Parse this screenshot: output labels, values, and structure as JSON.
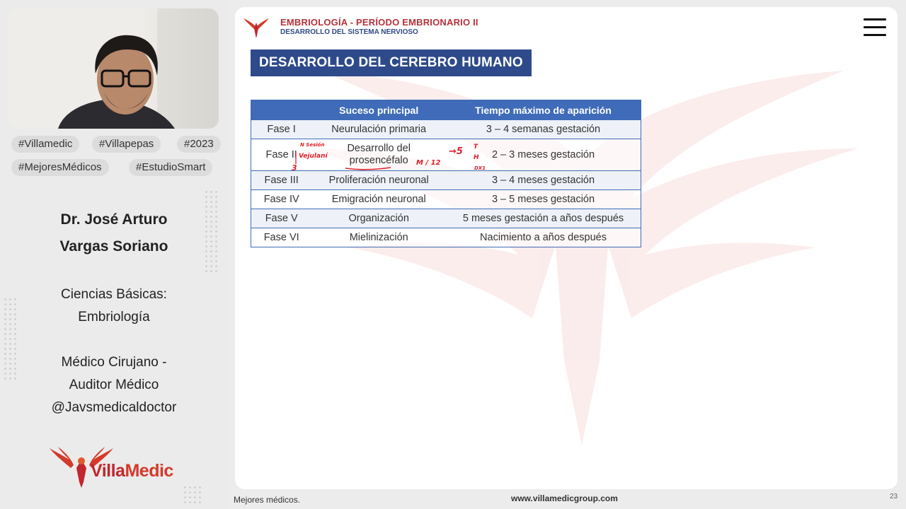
{
  "sidebar": {
    "tags": [
      "#Villamedic",
      "#Villapepas",
      "#2023",
      "#MejoresMédicos",
      "#EstudioSmart"
    ],
    "doctor_name_line1": "Dr. José Arturo",
    "doctor_name_line2": "Vargas Soriano",
    "area_line1": "Ciencias Básicas:",
    "area_line2": "Embriología",
    "role_line1": "Médico Cirujano -",
    "role_line2": "Auditor Médico",
    "handle": "@Javsmedicaldoctor",
    "logo_part1": "Villa",
    "logo_part2": "Medic"
  },
  "slide": {
    "course_title": "EMBRIOLOGÍA - PERÍODO EMBRIONARIO II",
    "course_subtitle": "DESARROLLO DEL SISTEMA NERVIOSO",
    "section_title": "DESARROLLO DEL CEREBRO HUMANO",
    "table": {
      "headers": [
        "",
        "Suceso principal",
        "Tiempo máximo de aparición"
      ],
      "rows": [
        {
          "phase": "Fase I",
          "event": "Neurulación primaria",
          "time": "3 – 4 semanas gestación"
        },
        {
          "phase": "Fase II",
          "event_line1": "Desarrollo del",
          "event_line2": "prosencéfalo",
          "time": "2 – 3 meses gestación"
        },
        {
          "phase": "Fase III",
          "event": "Proliferación neuronal",
          "time": "3 – 4 meses gestación"
        },
        {
          "phase": "Fase IV",
          "event": "Emigración neuronal",
          "time": "3 – 5 meses gestación"
        },
        {
          "phase": "Fase V",
          "event": "Organización",
          "time": "5 meses gestación a años después"
        },
        {
          "phase": "Fase VI",
          "event": "Mielinización",
          "time": "Nacimiento a años después"
        }
      ]
    },
    "annotations": {
      "left_top": "N Sesión",
      "left_mid": "Vejulaní",
      "left_bottom": "3",
      "right_m": "M / 12",
      "arrow_5": "→5",
      "stack_t": "T",
      "stack_h": "H",
      "stack_dx": "DX1"
    }
  },
  "footer": {
    "left": "Mejores médicos.",
    "center": "www.villamedicgroup.com",
    "page": "23"
  },
  "colors": {
    "brand_red": "#c2262e",
    "brand_blue": "#2e4a8a",
    "table_blue": "#3f6bb8",
    "annotation_red": "#e0202a"
  }
}
